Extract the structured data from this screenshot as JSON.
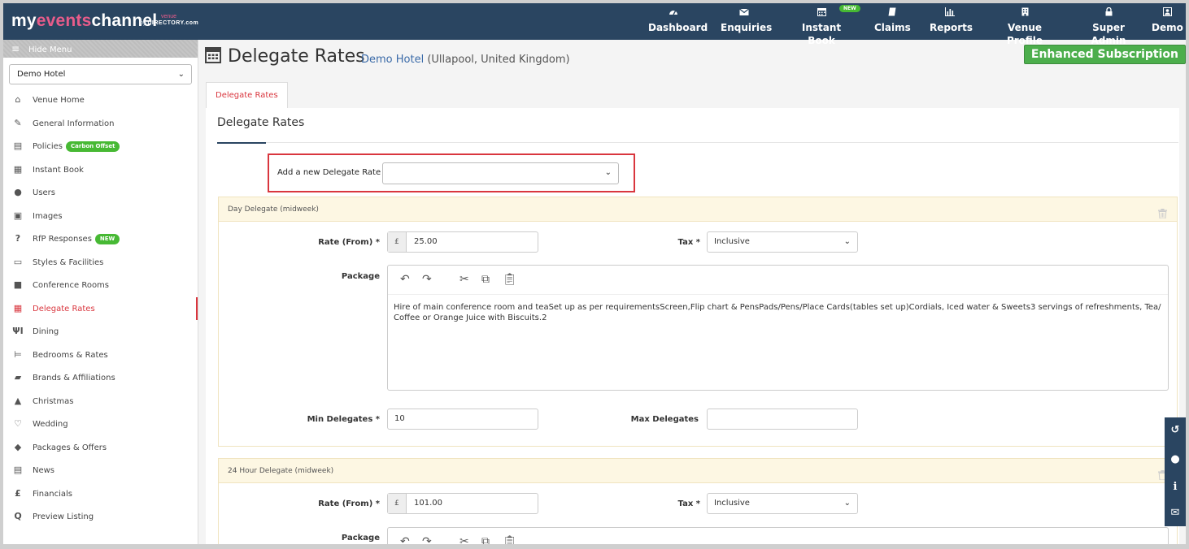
{
  "brand": {
    "logo_a": "my",
    "logo_b": "events",
    "logo_c": "channel",
    "by": "by",
    "venue_word": "venue",
    "directory_word": "DIRECTORY.com"
  },
  "nav": [
    {
      "label": "Dashboard",
      "icon": "dashboard-icon"
    },
    {
      "label": "Enquiries",
      "icon": "envelope-icon"
    },
    {
      "label": "Instant Book",
      "icon": "calendar-icon",
      "badge": "NEW"
    },
    {
      "label": "Claims",
      "icon": "book-icon"
    },
    {
      "label": "Reports",
      "icon": "bar-chart-icon"
    },
    {
      "label": "Venue Profile",
      "icon": "building-icon"
    },
    {
      "label": "Super Admin",
      "icon": "lock-icon"
    },
    {
      "label": "Demo",
      "icon": "user-icon"
    }
  ],
  "sidebar": {
    "hide_menu": "Hide Menu",
    "venue_select": "Demo Hotel",
    "items": [
      {
        "label": "Venue Home",
        "icon": "home-icon"
      },
      {
        "label": "General Information",
        "icon": "edit-icon"
      },
      {
        "label": "Policies",
        "icon": "document-icon",
        "badge": "Carbon Offset"
      },
      {
        "label": "Instant Book",
        "icon": "calendar-icon"
      },
      {
        "label": "Users",
        "icon": "user-icon"
      },
      {
        "label": "Images",
        "icon": "image-icon"
      },
      {
        "label": "RfP Responses",
        "icon": "question-icon",
        "badge": "NEW"
      },
      {
        "label": "Styles & Facilities",
        "icon": "monitor-icon"
      },
      {
        "label": "Conference Rooms",
        "icon": "briefcase-icon"
      },
      {
        "label": "Delegate Rates",
        "icon": "calculator-icon",
        "active": true
      },
      {
        "label": "Dining",
        "icon": "cutlery-icon"
      },
      {
        "label": "Bedrooms & Rates",
        "icon": "bed-icon"
      },
      {
        "label": "Brands & Affiliations",
        "icon": "book-icon"
      },
      {
        "label": "Christmas",
        "icon": "tree-icon"
      },
      {
        "label": "Wedding",
        "icon": "heart-icon"
      },
      {
        "label": "Packages & Offers",
        "icon": "tag-icon"
      },
      {
        "label": "News",
        "icon": "newspaper-icon"
      },
      {
        "label": "Financials",
        "icon": "pound-icon"
      },
      {
        "label": "Preview Listing",
        "icon": "search-icon"
      }
    ]
  },
  "main": {
    "title": "Delegate Rates",
    "venue_name": "Demo Hotel",
    "venue_location": "(Ullapool, United Kingdom)",
    "subscription": "Enhanced Subscription",
    "tab": "Delegate Rates",
    "section_title": "Delegate Rates",
    "add_label": "Add a new Delegate Rate",
    "add_value": ""
  },
  "rates": [
    {
      "title": "Day Delegate (midweek)",
      "rate_label": "Rate (From)",
      "currency": "£",
      "rate": "25.00",
      "tax_label": "Tax",
      "tax": "Inclusive",
      "package_label": "Package",
      "package_text": "Hire of main conference room and teaSet up as per requirementsScreen,Flip chart & PensPads/Pens/Place Cards(tables set up)Cordials, Iced water & Sweets3 servings of refreshments, Tea/ Coffee or Orange Juice with Biscuits.2",
      "min_label": "Min Delegates",
      "min": "10",
      "max_label": "Max Delegates",
      "max": ""
    },
    {
      "title": "24 Hour Delegate (midweek)",
      "rate_label": "Rate (From)",
      "currency": "£",
      "rate": "101.00",
      "tax_label": "Tax",
      "tax": "Inclusive",
      "package_label": "Package"
    }
  ],
  "required_mark": "*",
  "colors": {
    "nav_bg": "#2a4561",
    "accent_red": "#d9363e",
    "badge_green": "#47b934",
    "subscription_green": "#4cae4c",
    "rate_header": "#fdf7e3"
  }
}
